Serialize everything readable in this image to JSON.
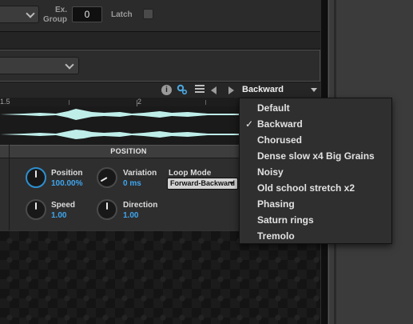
{
  "top_bar": {
    "ex_group_label_line1": "Ex.",
    "ex_group_label_line2": "Group",
    "ex_group_value": "0",
    "latch_label": "Latch"
  },
  "toolbar": {
    "info_glyph": "i",
    "preset_current": "Backward"
  },
  "ruler": {
    "tick_1": "1.5",
    "tick_2": "2"
  },
  "position_section": {
    "title": "POSITION",
    "params": [
      {
        "name": "Position",
        "value": "100.00%"
      },
      {
        "name": "Variation",
        "value": "0 ms"
      },
      {
        "name": "Speed",
        "value": "1.00"
      },
      {
        "name": "Direction",
        "value": "1.00"
      }
    ],
    "loop_mode_label": "Loop Mode",
    "loop_mode_value": "Forward-Backward"
  },
  "preset_menu": {
    "checkmark": "✓",
    "selected": "Backward",
    "items": [
      {
        "label": "Default"
      },
      {
        "label": "Backward"
      },
      {
        "label": "Chorused"
      },
      {
        "label": "Dense slow x4 Big Grains"
      },
      {
        "label": "Noisy"
      },
      {
        "label": "Old school stretch x2"
      },
      {
        "label": "Phasing"
      },
      {
        "label": "Saturn rings"
      },
      {
        "label": "Tremolo"
      }
    ]
  },
  "colors": {
    "accent": "#3ea6ee",
    "waveform": "#bfeee9"
  }
}
